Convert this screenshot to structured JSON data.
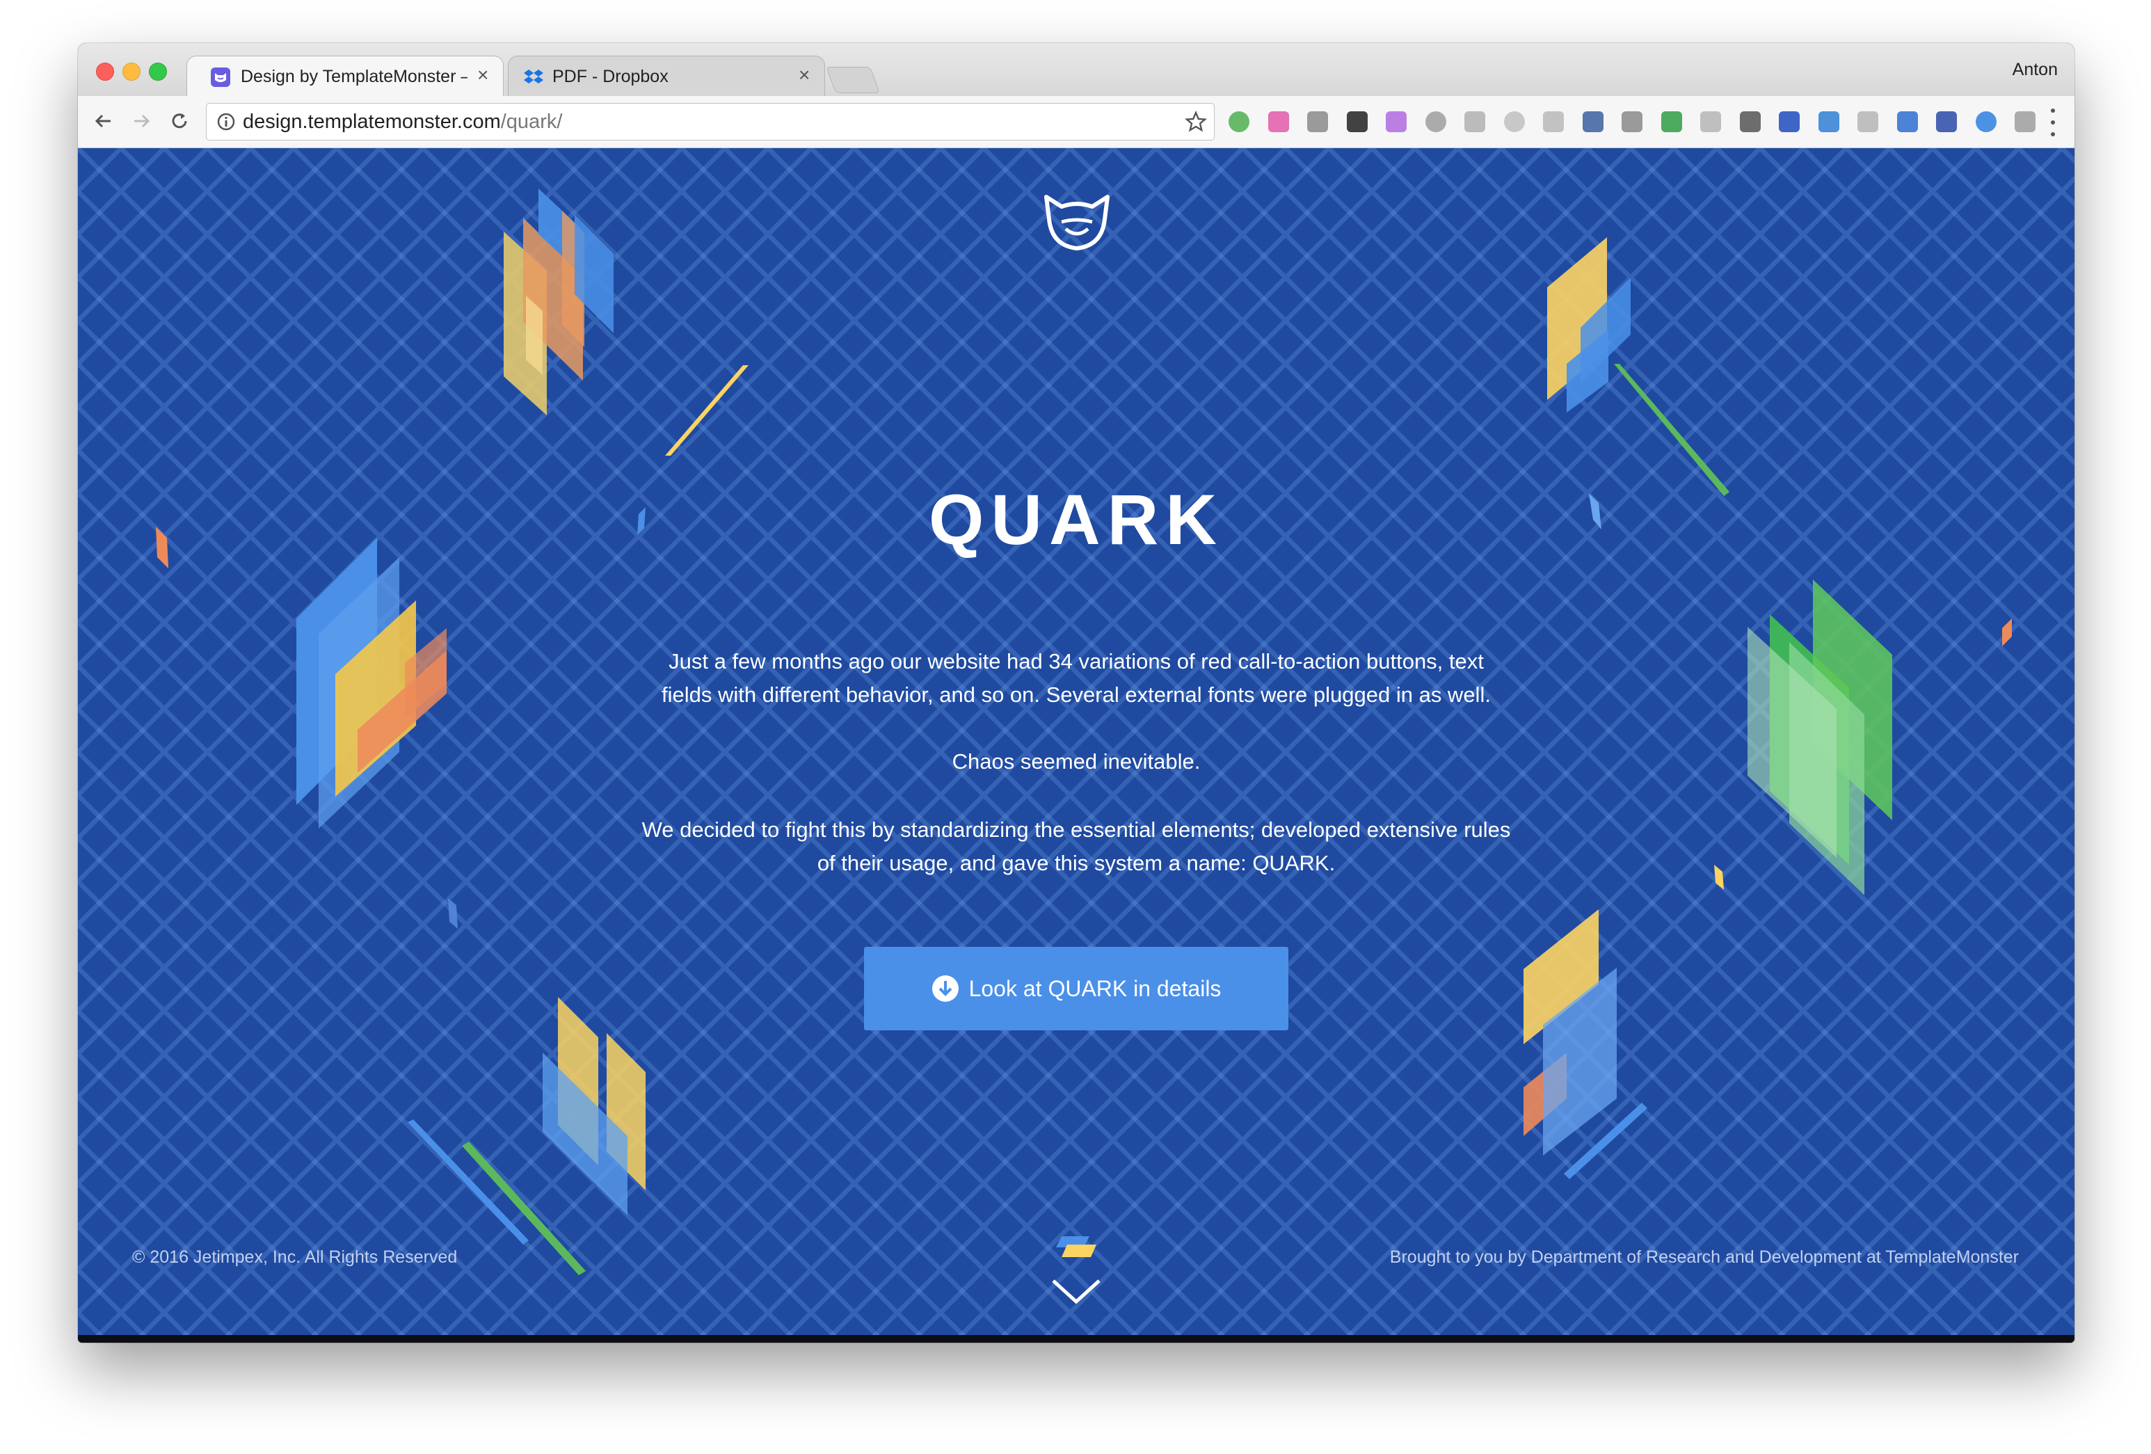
{
  "browser": {
    "tabs": [
      {
        "title": "Design by TemplateMonster —",
        "active": true,
        "favicon": "templatemonster-favicon"
      },
      {
        "title": "PDF - Dropbox",
        "active": false,
        "favicon": "dropbox-favicon"
      }
    ],
    "profile_name": "Anton",
    "url_host": "design.templatemonster.com",
    "url_path": "/quark/",
    "extension_icons": [
      "green-circle",
      "pink-square",
      "dropbox",
      "function",
      "pink-leaf",
      "gray-square",
      "gray-box",
      "gray-circle",
      "gray-diamond",
      "s-logo",
      "id-badge",
      "green-card",
      "gray-image",
      "thumbs-up",
      "blue-stripe",
      "blue-monitor",
      "gray-cloud",
      "blue-crop",
      "blue-grid",
      "blue-globe",
      "gray-shield"
    ]
  },
  "page": {
    "title": "QUARK",
    "paragraph_1_line_1": "Just a few months ago our website had 34 variations of red call-to-action buttons, text",
    "paragraph_1_line_2": "fields with different behavior, and so on. Several external fonts were plugged in as well.",
    "paragraph_2": "Chaos seemed inevitable.",
    "paragraph_3_line_1": "We decided to fight this by standardizing the essential elements; developed extensive rules",
    "paragraph_3_line_2": "of their usage, and gave this system a name: QUARK.",
    "cta_label": "Look at QUARK in details",
    "footer_left": "© 2016 Jetimpex, Inc. All Rights Reserved",
    "footer_right": "Brought to you by Department of Research and Development at TemplateMonster"
  },
  "colors": {
    "background": "#1f4aa0",
    "button": "#4a90e8",
    "text": "#ffffff",
    "footer_text": "#c2d0ef",
    "accent_yellow": "#fcd462",
    "accent_orange": "#ee8a5a",
    "accent_green": "#62c05a",
    "accent_blue": "#4a90e8"
  }
}
